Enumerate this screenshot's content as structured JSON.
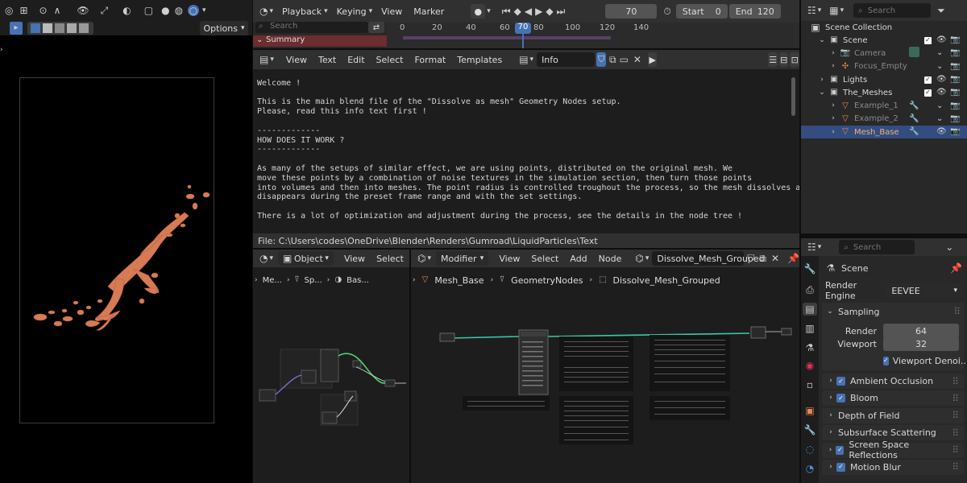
{
  "viewport": {
    "options_label": "Options"
  },
  "timeline": {
    "menus": [
      "Playback",
      "Keying",
      "View",
      "Marker"
    ],
    "current_frame": "70",
    "start_label": "Start",
    "start_value": "0",
    "end_label": "End",
    "end_value": "120",
    "search_placeholder": "Search",
    "summary_label": "Summary",
    "ruler_ticks": [
      "0",
      "20",
      "40",
      "60",
      "80",
      "100",
      "120",
      "140"
    ],
    "ruler_current": "70"
  },
  "text_editor": {
    "menus": [
      "View",
      "Text",
      "Edit",
      "Select",
      "Format",
      "Templates"
    ],
    "datablock": "Info",
    "lines": [
      "Welcome !",
      "",
      "This is the main blend file of the \"Dissolve as mesh\" Geometry Nodes setup.",
      "Please, read this info text first !",
      "",
      "-------------",
      "HOW DOES IT WORK ?",
      "-------------",
      "",
      "As many of the setups of similar effect, we are using points, distributed on the original mesh. We",
      "move these points by a combination of noise textures in the simulation section, then turn those points",
      "into volumes and then into meshes. The point radius is controlled troughout the process, so the mesh dissolves and",
      "disappears during the preset frame range and with the set settings.",
      "",
      "There is a lot of optimization and adjustment during the process, see the details in the node tree !"
    ],
    "footer": "File: C:\\Users\\codes\\OneDrive\\Blender\\Renders\\Gumroad\\LiquidParticles\\Text"
  },
  "node_small": {
    "mode": "Object",
    "menus": [
      "View",
      "Select"
    ],
    "breadcrumb": [
      "Me...",
      "Sp...",
      "Bas..."
    ]
  },
  "node_main": {
    "mode": "Modifier",
    "menus": [
      "View",
      "Select",
      "Add",
      "Node"
    ],
    "tree_name": "Dissolve_Mesh_Grouped",
    "breadcrumb": [
      "Mesh_Base",
      "GeometryNodes",
      "Dissolve_Mesh_Grouped"
    ]
  },
  "outliner": {
    "search_placeholder": "Search",
    "root": "Scene Collection",
    "items": [
      {
        "label": "Scene",
        "indent": 1,
        "type": "collection",
        "expanded": true,
        "dim": false,
        "selected": false
      },
      {
        "label": "Camera",
        "indent": 2,
        "type": "camera",
        "expanded": false,
        "dim": true,
        "selected": false
      },
      {
        "label": "Focus_Empty",
        "indent": 2,
        "type": "empty",
        "expanded": false,
        "dim": true,
        "selected": false
      },
      {
        "label": "Lights",
        "indent": 1,
        "type": "collection",
        "expanded": false,
        "dim": false,
        "selected": false
      },
      {
        "label": "The_Meshes",
        "indent": 1,
        "type": "collection",
        "expanded": true,
        "dim": false,
        "selected": false
      },
      {
        "label": "Example_1",
        "indent": 2,
        "type": "mesh",
        "expanded": false,
        "dim": true,
        "selected": false
      },
      {
        "label": "Example_2",
        "indent": 2,
        "type": "mesh",
        "expanded": false,
        "dim": true,
        "selected": false
      },
      {
        "label": "Mesh_Base",
        "indent": 2,
        "type": "mesh",
        "expanded": false,
        "dim": false,
        "selected": true
      }
    ]
  },
  "properties": {
    "search_placeholder": "Search",
    "scene_name": "Scene",
    "render_engine_label": "Render Engine",
    "render_engine_value": "EEVEE",
    "sampling_label": "Sampling",
    "render_label": "Render",
    "render_value": "64",
    "viewport_label": "Viewport",
    "viewport_value": "32",
    "viewport_denoise_label": "Viewport Denoi...",
    "panels": [
      {
        "label": "Ambient Occlusion",
        "checkbox": true
      },
      {
        "label": "Bloom",
        "checkbox": true
      },
      {
        "label": "Depth of Field",
        "checkbox": false
      },
      {
        "label": "Subsurface Scattering",
        "checkbox": false
      },
      {
        "label": "Screen Space Reflections",
        "checkbox": true
      },
      {
        "label": "Motion Blur",
        "checkbox": true
      }
    ]
  },
  "colors": {
    "accent": "#4772b3",
    "orange": "#e8874d",
    "node_link": "#38c8a6",
    "summary_bar": "#6b2d2d"
  }
}
